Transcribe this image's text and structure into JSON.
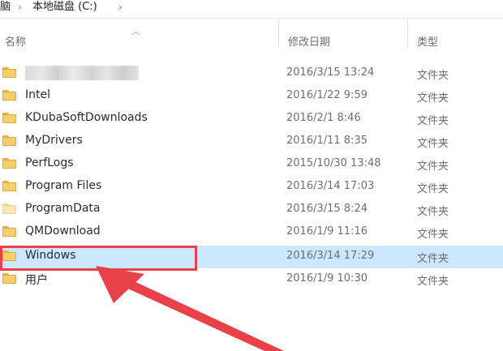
{
  "breadcrumb": {
    "crumbs": [
      "脑",
      "本地磁盘 (C:)"
    ],
    "separator": "›"
  },
  "columns": {
    "name": "名称",
    "modified": "修改日期",
    "type": "类型"
  },
  "rows": [
    {
      "name": "",
      "date": "2016/3/15 13:24",
      "type": "文件夹",
      "blurred": true
    },
    {
      "name": "Intel",
      "date": "2016/1/22 9:59",
      "type": "文件夹"
    },
    {
      "name": "KDubaSoftDownloads",
      "date": "2016/2/1 8:46",
      "type": "文件夹"
    },
    {
      "name": "MyDrivers",
      "date": "2016/1/11 8:35",
      "type": "文件夹"
    },
    {
      "name": "PerfLogs",
      "date": "2015/10/30 13:48",
      "type": "文件夹"
    },
    {
      "name": "Program Files",
      "date": "2016/3/14 17:03",
      "type": "文件夹"
    },
    {
      "name": "ProgramData",
      "date": "2016/3/15 8:24",
      "type": "文件夹"
    },
    {
      "name": "QMDownload",
      "date": "2016/1/9 11:16",
      "type": "文件夹"
    },
    {
      "name": "Windows",
      "date": "2016/3/14 17:29",
      "type": "文件夹",
      "selected": true
    },
    {
      "name": "用户",
      "date": "2016/1/9 10:30",
      "type": "文件夹"
    }
  ],
  "icons": {
    "folder": "folder-icon",
    "sort": "sort-up-icon"
  },
  "colors": {
    "selection": "#cce8ff",
    "annotation": "#e8414a",
    "folder": "#f6cf6a"
  }
}
